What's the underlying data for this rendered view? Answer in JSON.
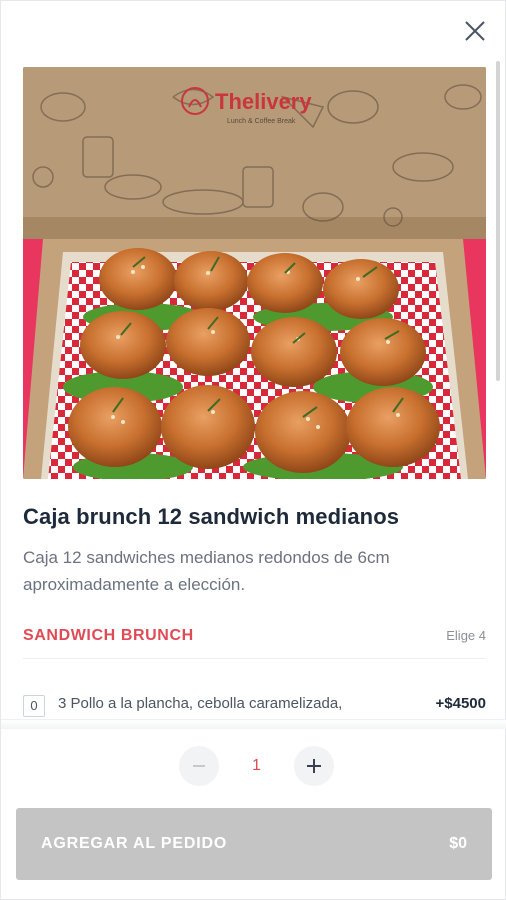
{
  "image": {
    "logo_text": "Thelivery",
    "logo_tagline": "Lunch & Coffee Break"
  },
  "product": {
    "title": "Caja brunch 12 sandwich medianos",
    "description": "Caja 12 sandwiches medianos redondos de 6cm aproximadamente a elección."
  },
  "section": {
    "title": "SANDWICH BRUNCH",
    "hint": "Elige 4"
  },
  "options": [
    {
      "qty": "0",
      "label": "3 Pollo a la plancha, cebolla caramelizada,",
      "price": "+$4500"
    }
  ],
  "quantity": {
    "value": "1"
  },
  "footer": {
    "add_label": "AGREGAR AL PEDIDO",
    "total": "$0"
  },
  "colors": {
    "accent": "#e04a55",
    "button_disabled": "#c4c4c4",
    "title": "#1e2a3a",
    "background_pink": "#e8365f"
  },
  "icons": {
    "close": "close-icon",
    "minus": "minus-icon",
    "plus": "plus-icon"
  }
}
